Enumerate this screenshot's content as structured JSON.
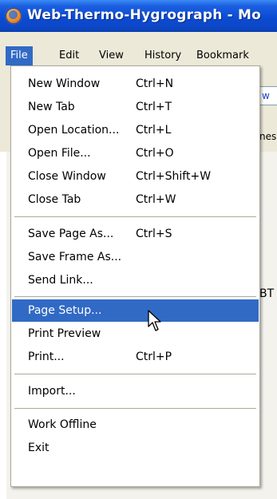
{
  "window": {
    "title": "Web-Thermo-Hygrograph - Mo"
  },
  "menubar": {
    "items": [
      {
        "label": "File"
      },
      {
        "label": "Edit"
      },
      {
        "label": "View"
      },
      {
        "label": "History"
      },
      {
        "label": "Bookmark"
      }
    ]
  },
  "background": {
    "url_fragment": "w",
    "tab_fragment": "nes",
    "content_fragment": "BT"
  },
  "file_menu": {
    "items": [
      {
        "label": "New Window",
        "shortcut": "Ctrl+N"
      },
      {
        "label": "New Tab",
        "shortcut": "Ctrl+T"
      },
      {
        "label": "Open Location...",
        "shortcut": "Ctrl+L"
      },
      {
        "label": "Open File...",
        "shortcut": "Ctrl+O"
      },
      {
        "label": "Close Window",
        "shortcut": "Ctrl+Shift+W"
      },
      {
        "label": "Close Tab",
        "shortcut": "Ctrl+W"
      },
      {
        "label": "Save Page As...",
        "shortcut": "Ctrl+S"
      },
      {
        "label": "Save Frame As...",
        "shortcut": ""
      },
      {
        "label": "Send Link...",
        "shortcut": ""
      },
      {
        "label": "Page Setup...",
        "shortcut": ""
      },
      {
        "label": "Print Preview",
        "shortcut": ""
      },
      {
        "label": "Print...",
        "shortcut": "Ctrl+P"
      },
      {
        "label": "Import...",
        "shortcut": ""
      },
      {
        "label": "Work Offline",
        "shortcut": ""
      },
      {
        "label": "Exit",
        "shortcut": ""
      }
    ],
    "highlighted": "Page Setup..."
  },
  "colors": {
    "highlight": "#316ac5",
    "titlebar": "#0a4bd4",
    "chrome": "#ece9d8"
  },
  "icons": {
    "app": "firefox-logo-icon",
    "cursor": "mouse-pointer-icon"
  }
}
